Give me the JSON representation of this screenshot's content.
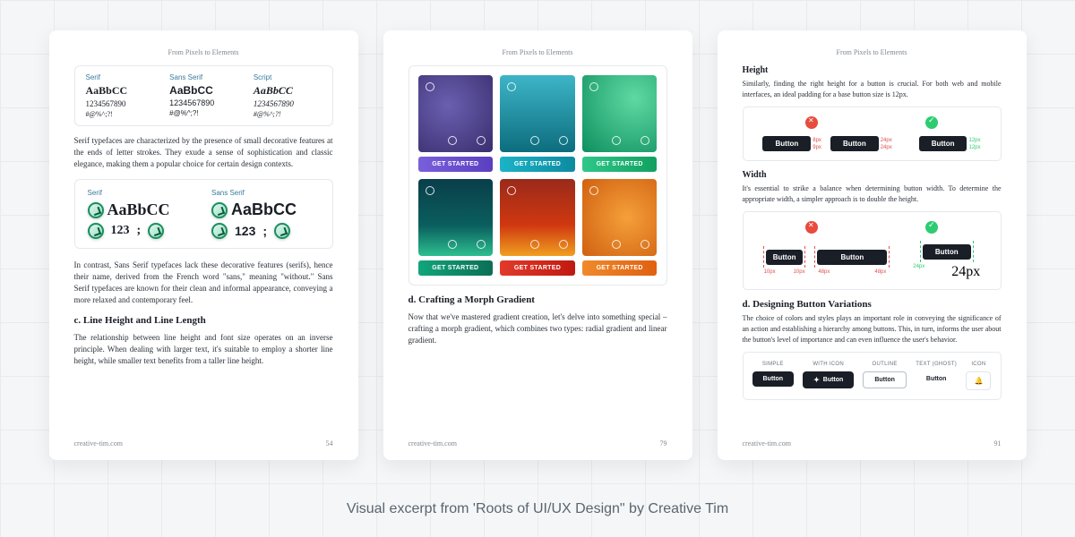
{
  "caption": "Visual excerpt from 'Roots of UI/UX Design\" by Creative Tim",
  "footer_site": "creative-tim.com",
  "page_header": "From Pixels to Elements",
  "page1": {
    "page_number": "54",
    "serif_label": "Serif",
    "sans_label": "Sans Serif",
    "script_label": "Script",
    "sample_letters": "AaBbCC",
    "sample_numbers": "1234567890",
    "sample_symbols": "#@%^;?!",
    "paragraph1": "Serif typefaces are characterized by the presence of small decorative features at the ends of letter strokes. They exude a sense of sophistication and classic elegance, making them a popular choice for certain design contexts.",
    "row2_serif": "Serif",
    "row2_sans": "Sans Serif",
    "row2_letters": "AaBbCC",
    "row2_nums": "123",
    "row2_punct": ";",
    "paragraph2": "In contrast, Sans Serif typefaces lack these decorative features (serifs), hence their name, derived from the French word \"sans,\" meaning \"without.\" Sans Serif typefaces are known for their clean and informal appearance, conveying a more relaxed and contemporary feel.",
    "subhead": "c. Line Height and Line Length",
    "paragraph3": "The relationship between line height and font size operates on an inverse principle. When dealing with larger text, it's suitable to employ a shorter line height, while smaller text benefits from a taller line height."
  },
  "page2": {
    "page_number": "79",
    "cta_label": "GET STARTED",
    "subhead": "d. Crafting a Morph Gradient",
    "paragraph": "Now that we've mastered gradient creation, let's delve into something special – crafting a morph gradient, which combines two types: radial gradient and linear gradient."
  },
  "page3": {
    "page_number": "91",
    "height_heading": "Height",
    "height_text": "Similarly, finding the right height for a button is crucial. For both web and mobile interfaces, an ideal padding for a base button size is 12px.",
    "width_heading": "Width",
    "width_text": "It's essential to strike a balance when determining button width. To determine the appropriate width, a simpler approach is to double the height.",
    "btn_label": "Button",
    "dim_8px": "8px",
    "dim_9px": "9px",
    "dim_24px": "24px",
    "dim_12px": "12px",
    "dim_10px": "10px",
    "dim_48px": "48px",
    "variations_heading": "d. Designing Button Variations",
    "variations_text": "The choice of colors and styles plays an important role in conveying the significance of an action and establishing a hierarchy among buttons. This, in turn, informs the user about the button's level of importance and can even influence the user's behavior.",
    "var_simple": "SIMPLE",
    "var_withicon": "WITH ICON",
    "var_outline": "OUTLINE",
    "var_ghost": "TEXT (GHOST)",
    "var_icon": "ICON"
  }
}
